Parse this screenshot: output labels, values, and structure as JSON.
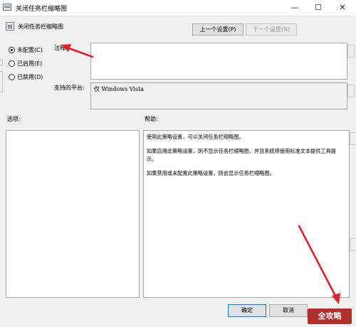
{
  "window": {
    "title": "关闭任务栏缩略图",
    "minimize_glyph": "—",
    "maximize_glyph": "☐",
    "close_glyph": "✕"
  },
  "header": {
    "policy_title": "关闭任务栏缩略图",
    "prev_setting_label": "上一个设置(P)",
    "next_setting_label": "下一个设置(N)"
  },
  "state_options": [
    {
      "label": "未配置(C)",
      "checked": true
    },
    {
      "label": "已启用(E)",
      "checked": false
    },
    {
      "label": "已禁用(D)",
      "checked": false
    }
  ],
  "comment": {
    "label": "注释:",
    "value": ""
  },
  "supported": {
    "label": "支持的平台:",
    "value": "仅 Windows Vista"
  },
  "options": {
    "label": "选项:"
  },
  "help": {
    "label": "帮助:",
    "paragraphs": [
      "使用此策略设置，可以关闭任务栏缩略图。",
      "如果启用此策略设置，则不显示任务栏缩略图，并且系统将使用标准文本提供工具提示。",
      "如果禁用或未配置此策略设置，则会显示任务栏缩略图。"
    ]
  },
  "footer": {
    "ok_label": "确定",
    "cancel_label": "取消"
  },
  "watermark": {
    "text": "全攻略"
  },
  "colors": {
    "annotation_arrow": "#e0202a",
    "focus_border": "#0078d7"
  }
}
